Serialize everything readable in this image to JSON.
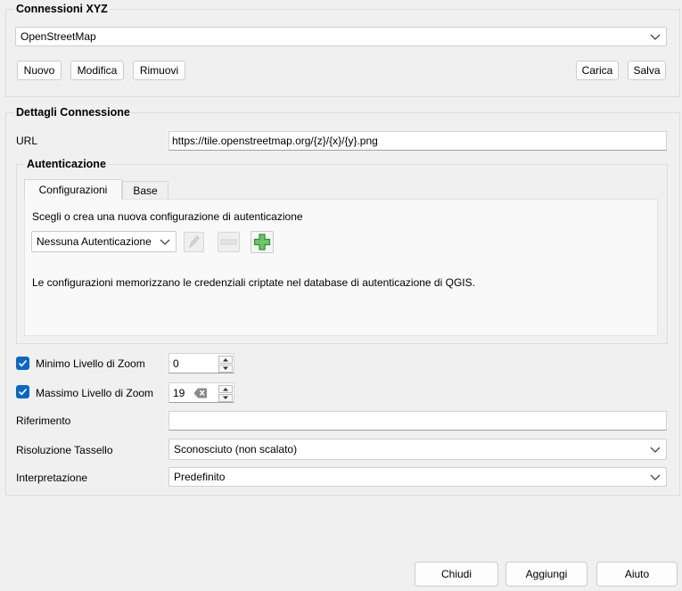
{
  "connections": {
    "title": "Connessioni XYZ",
    "selected": "OpenStreetMap",
    "buttons": {
      "new": "Nuovo",
      "edit": "Modifica",
      "remove": "Rimuovi",
      "load": "Carica",
      "save": "Salva"
    }
  },
  "details": {
    "title": "Dettagli Connessione",
    "url_label": "URL",
    "url_value": "https://tile.openstreetmap.org/{z}/{x}/{y}.png",
    "auth": {
      "title": "Autenticazione",
      "tabs": [
        "Configurazioni",
        "Base"
      ],
      "prompt": "Scegli o crea una nuova configurazione di autenticazione",
      "selected": "Nessuna Autenticazione",
      "note": "Le configurazioni memorizzano le credenziali criptate nel database di autenticazione di QGIS."
    },
    "min_zoom": {
      "label": "Minimo Livello di Zoom",
      "value": "0",
      "checked": true
    },
    "max_zoom": {
      "label": "Massimo Livello di Zoom",
      "value": "19",
      "checked": true
    },
    "referer": {
      "label": "Riferimento",
      "value": ""
    },
    "tile_resolution": {
      "label": "Risoluzione Tassello",
      "value": "Sconosciuto (non scalato)"
    },
    "interpretation": {
      "label": "Interpretazione",
      "value": "Predefinito"
    }
  },
  "footer": {
    "close": "Chiudi",
    "add": "Aggiungi",
    "help": "Aiuto"
  },
  "colors": {
    "background": "#f0f0f0",
    "checkbox": "#0a67c5",
    "add_icon": "#3aa33a"
  }
}
